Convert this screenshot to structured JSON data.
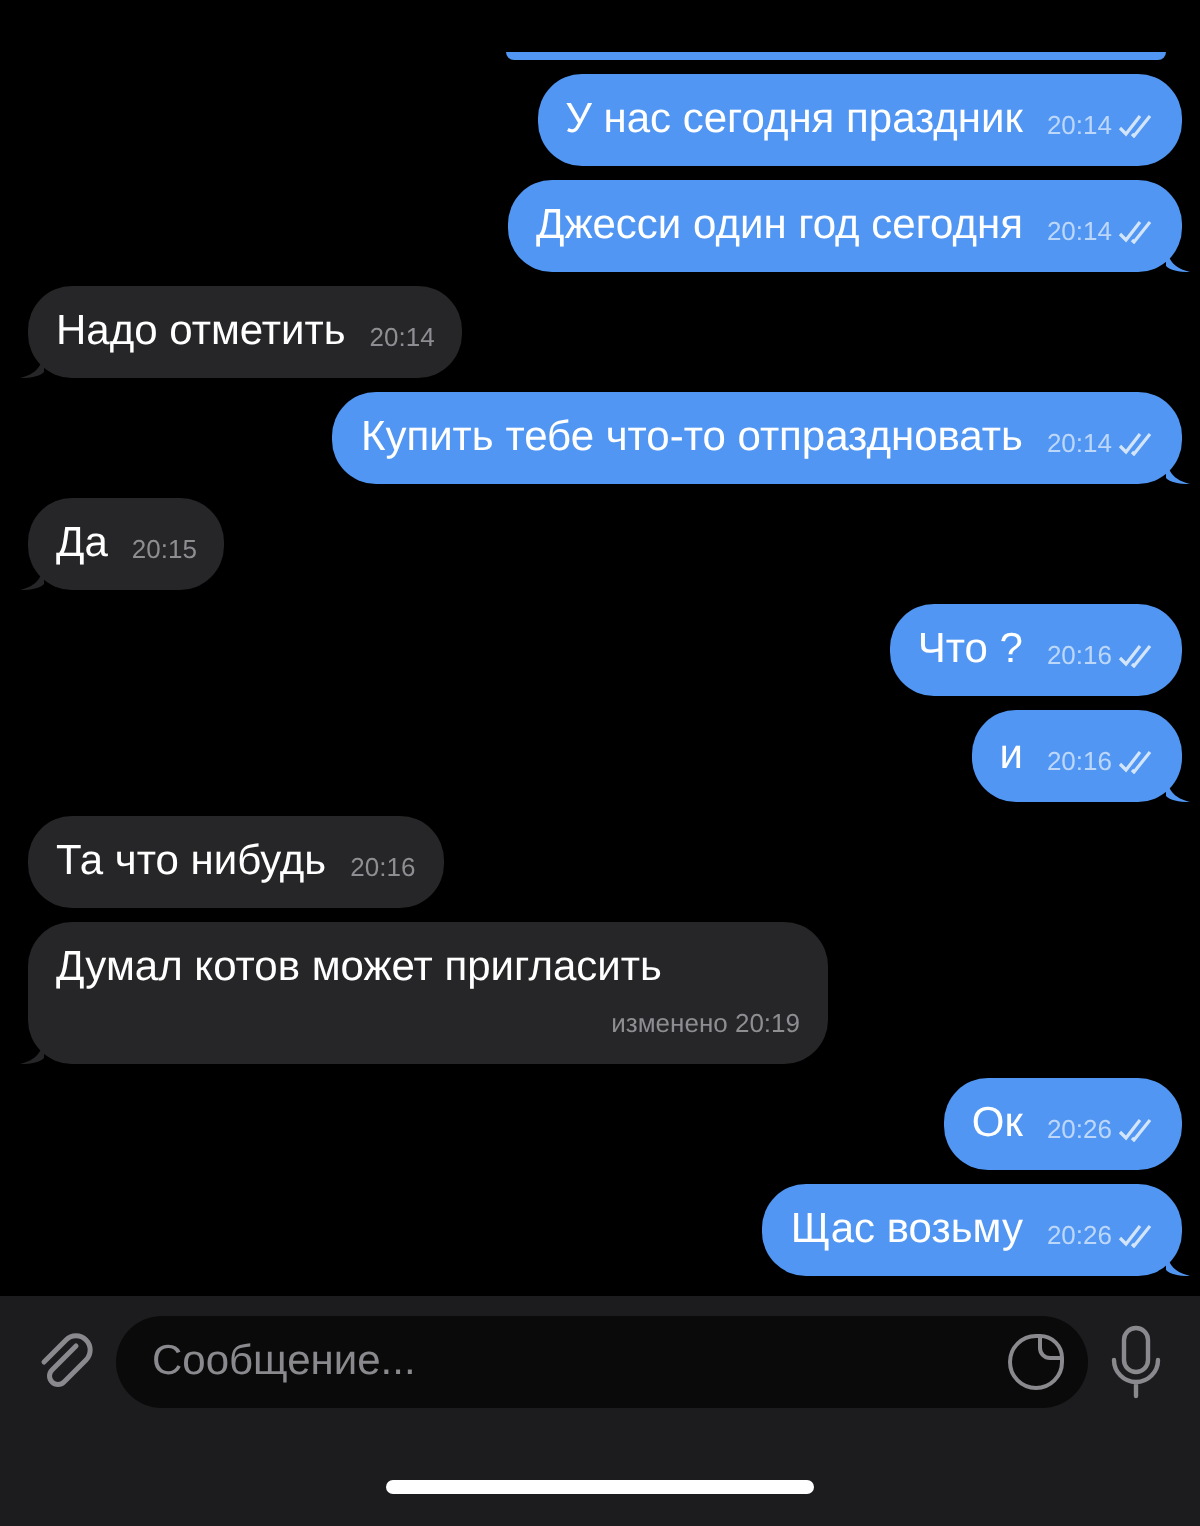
{
  "messages": [
    {
      "kind": "clipped"
    },
    {
      "kind": "outgoing",
      "text": "У нас сегодня праздник",
      "time": "20:14",
      "read": true,
      "tail": false
    },
    {
      "kind": "outgoing",
      "text": "Джесси один год сегодня",
      "time": "20:14",
      "read": true,
      "tail": true
    },
    {
      "kind": "incoming",
      "text": "Надо отметить",
      "time": "20:14",
      "tail": true
    },
    {
      "kind": "outgoing",
      "text": "Купить тебе что-то отпраздновать",
      "time": "20:14",
      "read": true,
      "tail": true
    },
    {
      "kind": "incoming",
      "text": "Да",
      "time": "20:15",
      "tail": true
    },
    {
      "kind": "outgoing",
      "text": "Что ?",
      "time": "20:16",
      "read": true,
      "tail": false
    },
    {
      "kind": "outgoing",
      "text": "и",
      "time": "20:16",
      "read": true,
      "tail": true
    },
    {
      "kind": "incoming",
      "text": "Та что нибудь",
      "time": "20:16",
      "tail": false
    },
    {
      "kind": "incoming",
      "text": "Думал котов может пригласить",
      "edited": "изменено",
      "time": "20:19",
      "tail": true
    },
    {
      "kind": "outgoing",
      "text": "Ок",
      "time": "20:26",
      "read": true,
      "tail": false
    },
    {
      "kind": "outgoing",
      "text": "Щас возьму",
      "time": "20:26",
      "read": true,
      "tail": true
    }
  ],
  "composer": {
    "placeholder": "Сообщение..."
  }
}
